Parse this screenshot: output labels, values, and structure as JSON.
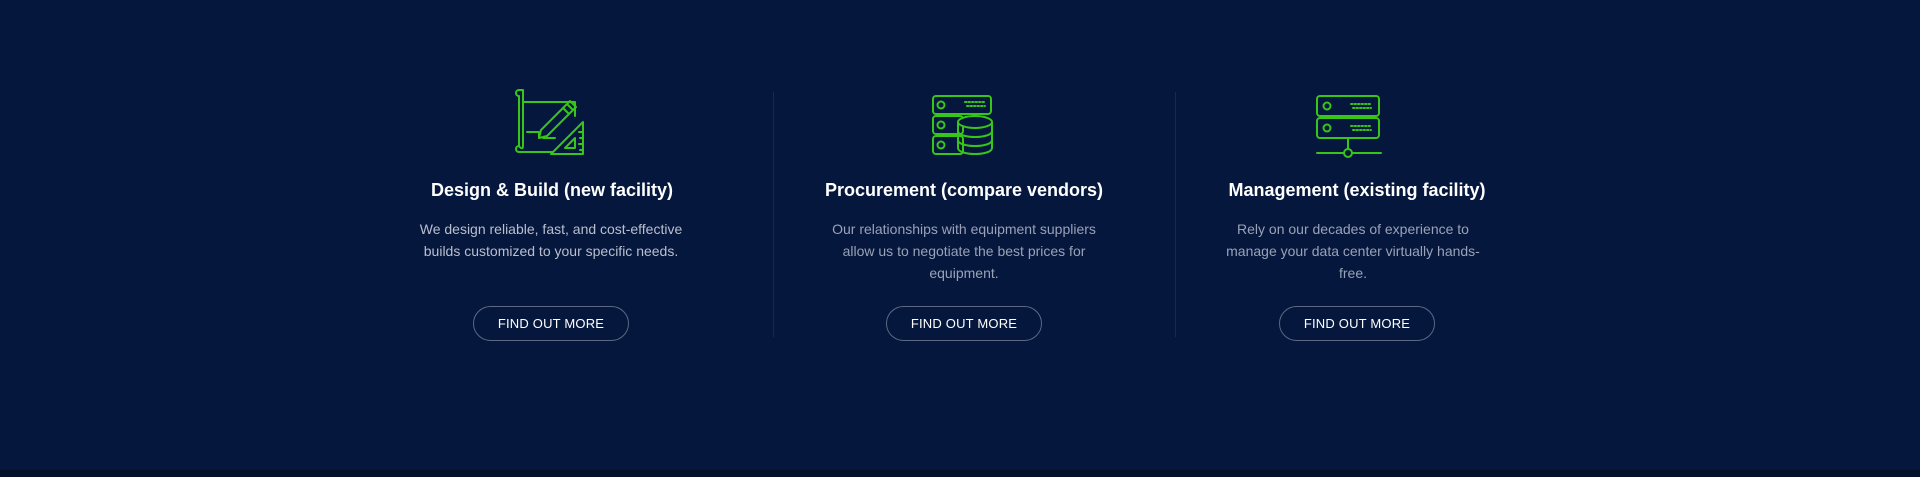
{
  "colors": {
    "background": "#06173d",
    "accent_green": "#37c51a",
    "text_white": "#ffffff",
    "text_muted": "#99a2b7",
    "button_border": "#5c6884"
  },
  "services": [
    {
      "icon": "blueprint-design-icon",
      "title": "Design & Build (new facility)",
      "description": "We design reliable, fast, and cost-effective builds customized to your specific needs.",
      "button_label": "FIND OUT MORE"
    },
    {
      "icon": "server-database-icon",
      "title": "Procurement  (compare vendors)",
      "description": "Our relationships with equipment suppliers allow us to negotiate the best prices for equipment.",
      "button_label": "FIND OUT MORE"
    },
    {
      "icon": "server-network-icon",
      "title": "Management  (existing facility)",
      "description": "Rely on our decades of experience to manage your data center virtually hands-free.",
      "button_label": "FIND OUT MORE"
    }
  ]
}
